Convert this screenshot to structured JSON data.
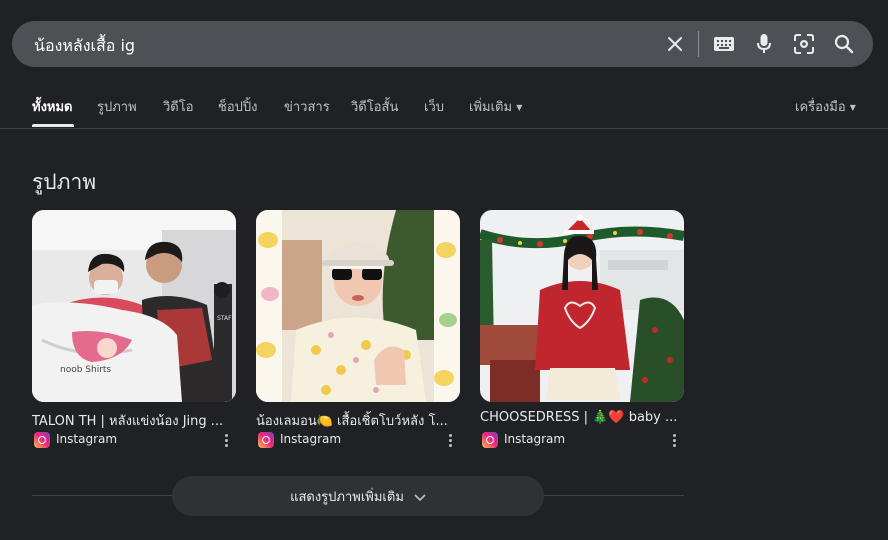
{
  "search": {
    "query": "น้องหลังเสื้อ ig"
  },
  "tabs": [
    {
      "label": "ทั้งหมด",
      "active": true
    },
    {
      "label": "รูปภาพ",
      "active": false
    },
    {
      "label": "วิดีโอ",
      "active": false
    },
    {
      "label": "ช็อปปิ้ง",
      "active": false
    },
    {
      "label": "ข่าวสาร",
      "active": false
    },
    {
      "label": "วิดีโอสั้น",
      "active": false
    },
    {
      "label": "เว็บ",
      "active": false
    },
    {
      "label": "เพิ่มเติม",
      "active": false
    }
  ],
  "tools_label": "เครื่องมือ",
  "section_title": "รูปภาพ",
  "results": [
    {
      "title": "TALON TH | หลังแข่งน้อง Jing ...",
      "source": "Instagram"
    },
    {
      "title": "น้องเลมอน🍋 เสื้อเชิ้ตโบว์หลัง โ...",
      "source": "Instagram"
    },
    {
      "title": "CHOOSEDRESS | 🎄❤️ baby ...",
      "source": "Instagram"
    }
  ],
  "photo_texts": {
    "shirt_print": "noob Shirts",
    "wall_sign": "STAFF"
  },
  "more_images_label": "แสดงรูปภาพเพิ่มเติม",
  "colors": {
    "background": "#202124",
    "search_bar": "#4d5156",
    "text": "#e8eaed",
    "muted": "#bdc1c6"
  }
}
